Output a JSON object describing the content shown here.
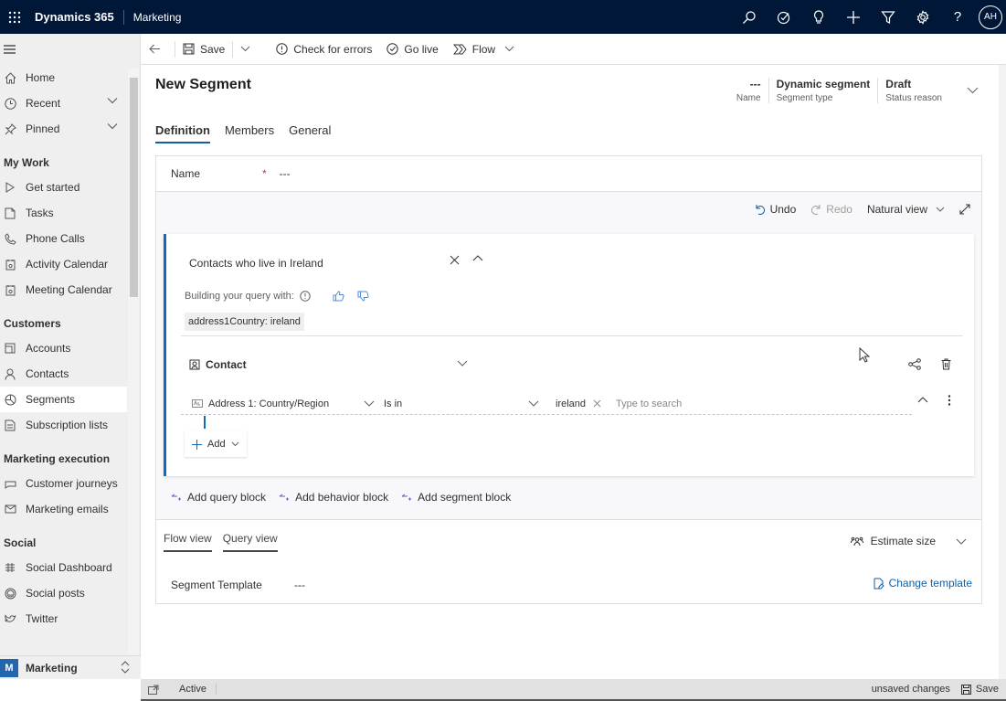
{
  "topbar": {
    "brand": "Dynamics 365",
    "app": "Marketing",
    "icons": [
      "search-icon",
      "task-flow-icon",
      "lightbulb-icon",
      "add-icon",
      "filter-icon",
      "settings-icon",
      "help-icon"
    ],
    "avatar_initials": "AH"
  },
  "sidebar": {
    "top_items": [
      {
        "label": "Home",
        "icon": "home-icon"
      },
      {
        "label": "Recent",
        "icon": "clock-icon",
        "expandable": true
      },
      {
        "label": "Pinned",
        "icon": "pin-icon",
        "expandable": true
      }
    ],
    "sections": [
      {
        "title": "My Work",
        "items": [
          {
            "label": "Get started",
            "icon": "play-icon"
          },
          {
            "label": "Tasks",
            "icon": "task-icon"
          },
          {
            "label": "Phone Calls",
            "icon": "phone-icon"
          },
          {
            "label": "Activity Calendar",
            "icon": "calendar-icon"
          },
          {
            "label": "Meeting Calendar",
            "icon": "calendar-icon"
          }
        ]
      },
      {
        "title": "Customers",
        "items": [
          {
            "label": "Accounts",
            "icon": "account-icon"
          },
          {
            "label": "Contacts",
            "icon": "person-icon"
          },
          {
            "label": "Segments",
            "icon": "segment-icon",
            "active": true
          },
          {
            "label": "Subscription lists",
            "icon": "list-icon"
          }
        ]
      },
      {
        "title": "Marketing execution",
        "items": [
          {
            "label": "Customer journeys",
            "icon": "journey-icon"
          },
          {
            "label": "Marketing emails",
            "icon": "mail-icon"
          }
        ]
      },
      {
        "title": "Social",
        "items": [
          {
            "label": "Social Dashboard",
            "icon": "dashboard-icon"
          },
          {
            "label": "Social posts",
            "icon": "emoji-icon"
          },
          {
            "label": "Twitter",
            "icon": "twitter-icon"
          }
        ]
      }
    ],
    "area": {
      "initial": "M",
      "label": "Marketing"
    }
  },
  "commandbar": {
    "save": "Save",
    "check_errors": "Check for errors",
    "go_live": "Go live",
    "flow": "Flow"
  },
  "form": {
    "title": "New Segment",
    "header_fields": [
      {
        "value": "---",
        "label": "Name"
      },
      {
        "value": "Dynamic segment",
        "label": "Segment type"
      },
      {
        "value": "Draft",
        "label": "Status reason"
      }
    ],
    "tabs": [
      {
        "label": "Definition",
        "active": true
      },
      {
        "label": "Members"
      },
      {
        "label": "General"
      }
    ],
    "name_label": "Name",
    "name_required": "*",
    "name_value": "---"
  },
  "designer": {
    "undo": "Undo",
    "redo": "Redo",
    "view_select": "Natural view",
    "query_block": {
      "title": "Contacts who live in Ireland",
      "building_label": "Building your query with:",
      "tag": "address1Country: ireland",
      "entity": "Contact",
      "condition": {
        "attribute": "Address 1: Country/Region",
        "operator": "Is in",
        "value": "ireland",
        "search_placeholder": "Type to search"
      },
      "add_label": "Add"
    },
    "add_blocks": [
      "Add query block",
      "Add behavior block",
      "Add segment block"
    ]
  },
  "bottom": {
    "view_tabs": [
      "Flow view",
      "Query view"
    ],
    "estimate": "Estimate size",
    "template_label": "Segment Template",
    "template_value": "---",
    "change_template": "Change template"
  },
  "statusbar": {
    "status": "Active",
    "unsaved": "unsaved changes",
    "save": "Save"
  }
}
